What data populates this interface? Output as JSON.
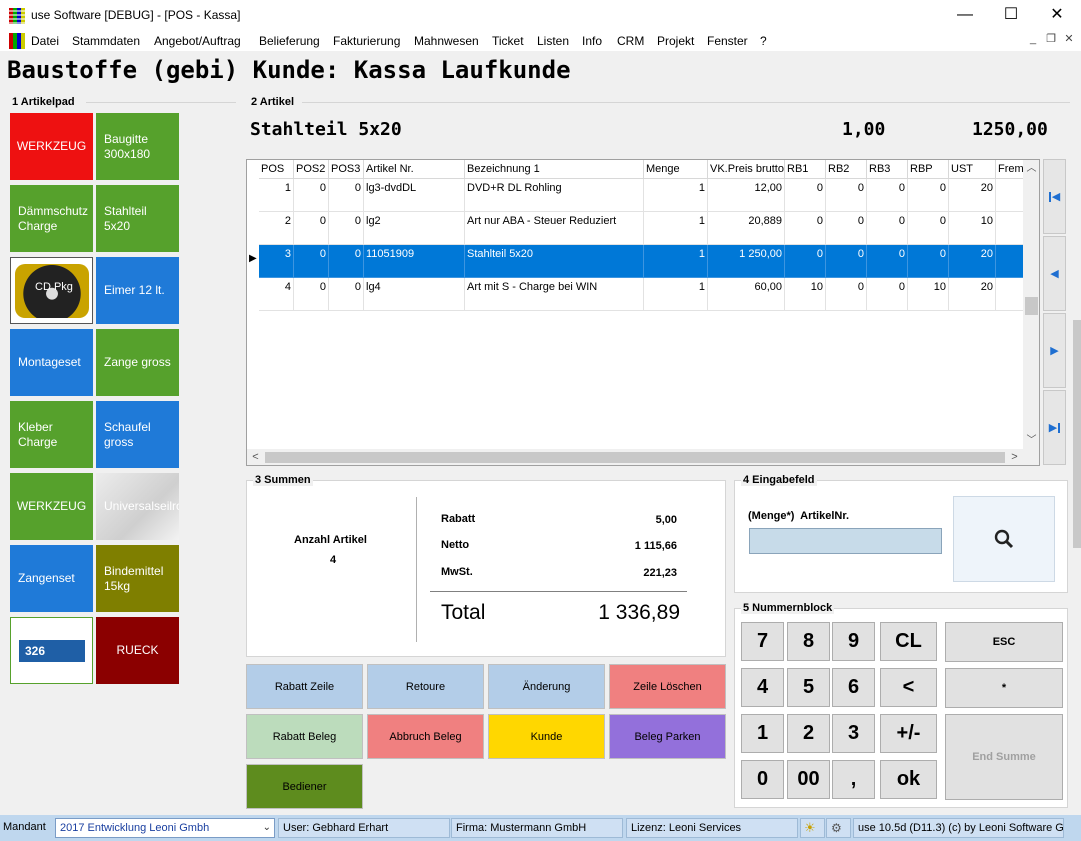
{
  "window": {
    "title": "use Software [DEBUG] - [POS - Kassa]",
    "minimize": "—",
    "maximize": "☐",
    "close": "✕"
  },
  "menu": {
    "items": [
      "Datei",
      "Stammdaten",
      "Angebot/Auftrag",
      "Belieferung",
      "Fakturierung",
      "Mahnwesen",
      "Ticket",
      "Listen",
      "Info",
      "CRM",
      "Projekt",
      "Fenster",
      "?"
    ]
  },
  "heading": "Baustoffe (gebi) Kunde: Kassa Laufkunde",
  "articlepad": {
    "title": "1 Artikelpad",
    "tiles": [
      {
        "label": "WERKZEUG",
        "color": "#ee1111"
      },
      {
        "label": "Baugitte 300x180",
        "color": "#56a12c"
      },
      {
        "label": "Dämmschutz Charge",
        "color": "#56a12c"
      },
      {
        "label": "Stahlteil 5x20",
        "color": "#56a12c"
      },
      {
        "label": "CD Pkg",
        "color": "#1a1a1a"
      },
      {
        "label": "Eimer 12 lt.",
        "color": "#1f7ad8"
      },
      {
        "label": "Montageset",
        "color": "#1f7ad8"
      },
      {
        "label": "Zange gross",
        "color": "#56a12c"
      },
      {
        "label": "Kleber Charge",
        "color": "#56a12c"
      },
      {
        "label": "Schaufel gross",
        "color": "#1f7ad8"
      },
      {
        "label": "WERKZEUG",
        "color": "#56a12c"
      },
      {
        "label": "Universalseilrolle",
        "color": "#e0e0e0"
      },
      {
        "label": "Zangenset",
        "color": "#1f7ad8"
      },
      {
        "label": "Bindemittel 15kg",
        "color": "#7f7f00"
      },
      {
        "label": "326",
        "color": "#1f5fa6"
      },
      {
        "label": "RUECK",
        "color": "#8b0000"
      }
    ]
  },
  "article": {
    "title": "2 Artikel",
    "name": "Stahlteil 5x20",
    "qty": "1,00",
    "price": "1250,00"
  },
  "grid": {
    "columns": [
      "POS",
      "POS2",
      "POS3",
      "Artikel Nr.",
      "Bezeichnung 1",
      "Menge",
      "VK.Preis brutto",
      "RB1",
      "RB2",
      "RB3",
      "RBP",
      "UST",
      "Frem"
    ],
    "rows": [
      [
        "1",
        "0",
        "0",
        "lg3-dvdDL",
        "DVD+R DL Rohling",
        "1",
        "12,00",
        "0",
        "0",
        "0",
        "0",
        "20",
        ""
      ],
      [
        "2",
        "0",
        "0",
        "lg2",
        "Art nur ABA - Steuer Reduziert",
        "1",
        "20,889",
        "0",
        "0",
        "0",
        "0",
        "10",
        ""
      ],
      [
        "3",
        "0",
        "0",
        "11051909",
        "Stahlteil 5x20",
        "1",
        "1 250,00",
        "0",
        "0",
        "0",
        "0",
        "20",
        ""
      ],
      [
        "4",
        "0",
        "0",
        "lg4",
        "Art mit S - Charge bei WIN",
        "1",
        "60,00",
        "10",
        "0",
        "0",
        "10",
        "20",
        ""
      ]
    ],
    "selected_row": 2,
    "row_pointer": "▶",
    "scroll_up": "︿",
    "scroll_down": "﹀",
    "scroll_left": "<",
    "scroll_right": ">"
  },
  "nav": {
    "first": "◀",
    "prev": "◀",
    "next": "▶",
    "last": "▶"
  },
  "summen": {
    "title": "3 Summen",
    "anzahl_label": "Anzahl Artikel",
    "anzahl_value": "4",
    "rabatt_label": "Rabatt",
    "rabatt_value": "5,00",
    "netto_label": "Netto",
    "netto_value": "1 115,66",
    "mwst_label": "MwSt.",
    "mwst_value": "221,23",
    "total_label": "Total",
    "total_value": "1 336,89"
  },
  "eingabe": {
    "title": "4 Eingabefeld",
    "label": "(Menge*)  ArtikelNr.",
    "value": ""
  },
  "numblock": {
    "title": "5 Nummernblock",
    "keys": [
      "7",
      "8",
      "9",
      "CL",
      "4",
      "5",
      "6",
      "<",
      "1",
      "2",
      "3",
      "+/-",
      "0",
      "00",
      ",",
      "ok"
    ],
    "esc": "ESC",
    "star": "*",
    "endsumme": "End Summe"
  },
  "actions": [
    {
      "label": "Rabatt Zeile",
      "color": "#b3cde8"
    },
    {
      "label": "Retoure",
      "color": "#b3cde8"
    },
    {
      "label": "Änderung",
      "color": "#b3cde8"
    },
    {
      "label": "Zeile Löschen",
      "color": "#f08080"
    },
    {
      "label": "Rabatt Beleg",
      "color": "#bcdcbc"
    },
    {
      "label": "Abbruch Beleg",
      "color": "#f08080"
    },
    {
      "label": "Kunde",
      "color": "#ffd700"
    },
    {
      "label": "Beleg Parken",
      "color": "#9370db"
    },
    {
      "label": "Bediener",
      "color": "#5e8c1e"
    }
  ],
  "status": {
    "mandant_label": "Mandant",
    "mandant_value": "2017  Entwicklung Leoni Gmbh",
    "user": "User: Gebhard Erhart",
    "firma": "Firma: Mustermann GmbH",
    "lizenz": "Lizenz: Leoni Services",
    "version": "use 10.5d (D11.3) (c) by Leoni Software G"
  }
}
